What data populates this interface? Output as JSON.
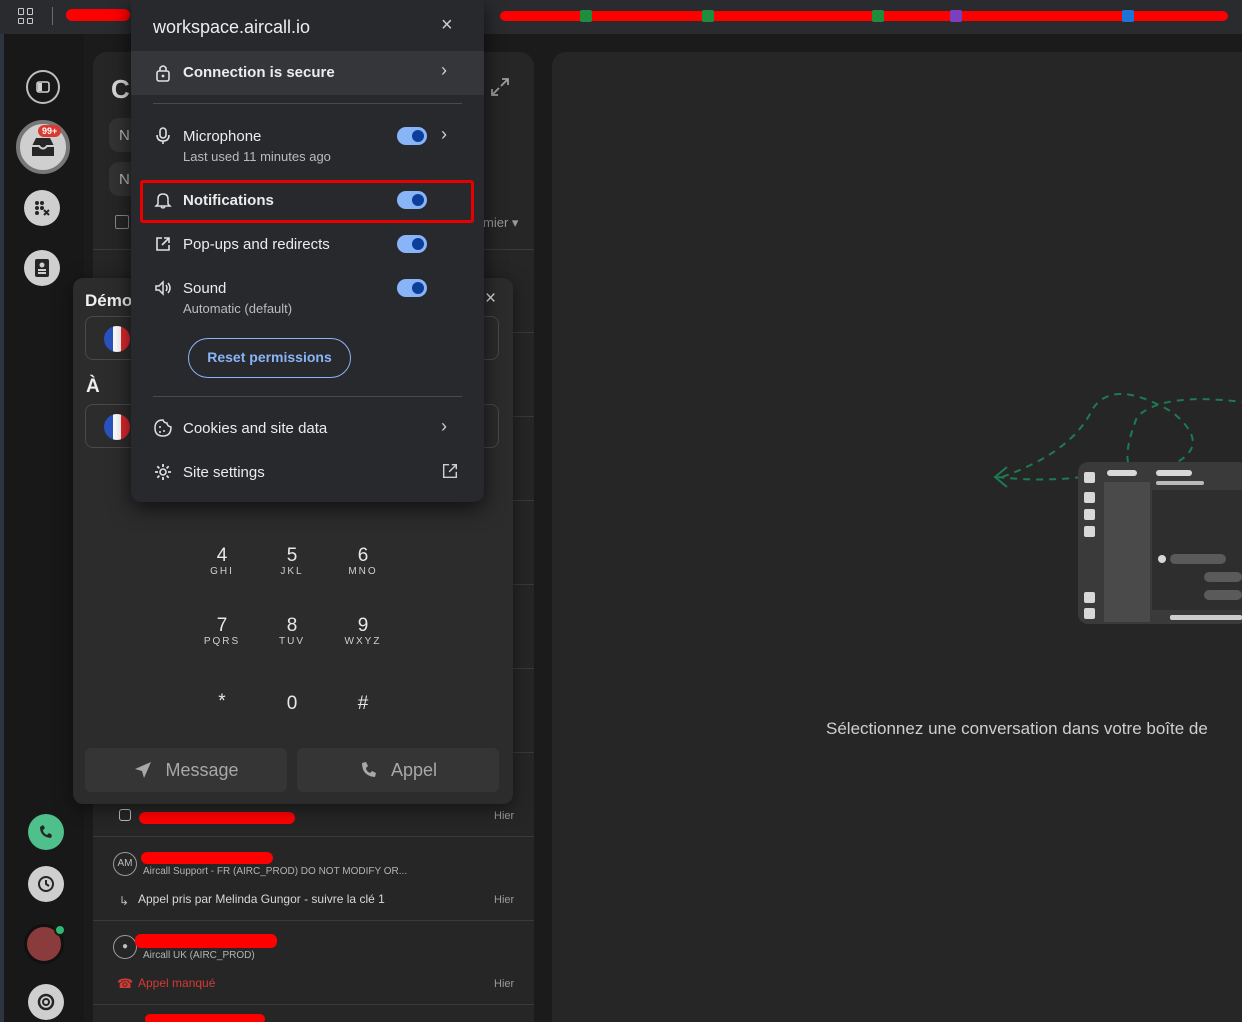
{
  "browser": {
    "site_host": "workspace.aircall.io"
  },
  "site_info": {
    "connection": "Connection is secure",
    "microphone": {
      "label": "Microphone",
      "sub": "Last used 11 minutes ago",
      "enabled": true
    },
    "notifications": {
      "label": "Notifications",
      "enabled": true
    },
    "popups": {
      "label": "Pop-ups and redirects",
      "enabled": true
    },
    "sound": {
      "label": "Sound",
      "sub": "Automatic (default)",
      "enabled": true
    },
    "reset_label": "Reset permissions",
    "cookies": "Cookies and site data",
    "site_settings": "Site settings",
    "close_glyph": "×",
    "chevron_glyph": "›",
    "accent_color": "#8ab4f8",
    "highlight_color": "#e60000"
  },
  "rail": {
    "badge": "99+"
  },
  "convo": {
    "header_letter": "C",
    "pill1": "N",
    "pill2": "N",
    "filter": "mier ▾",
    "rows": [
      {
        "time": "Hier"
      },
      {
        "initials": "AM",
        "company": "Aircall Support - FR (AIRC_PROD) DO NOT MODIFY OR...",
        "status": "Appel pris par Melinda Gungor - suivre la clé 1",
        "time": "Hier"
      },
      {
        "company": "Aircall UK (AIRC_PROD)",
        "status": "Appel manqué",
        "time": "Hier"
      }
    ]
  },
  "dialer": {
    "title": "Démo",
    "close": "×",
    "to_label": "À",
    "keys": [
      {
        "num": "4",
        "sub": "GHI"
      },
      {
        "num": "5",
        "sub": "JKL"
      },
      {
        "num": "6",
        "sub": "MNO"
      },
      {
        "num": "7",
        "sub": "PQRS"
      },
      {
        "num": "8",
        "sub": "TUV"
      },
      {
        "num": "9",
        "sub": "WXYZ"
      },
      {
        "num": "*",
        "sub": ""
      },
      {
        "num": "0",
        "sub": ""
      },
      {
        "num": "#",
        "sub": ""
      }
    ],
    "message_label": "Message",
    "call_label": "Appel"
  },
  "main": {
    "empty_text": "Sélectionnez une conversation dans votre boîte de"
  }
}
